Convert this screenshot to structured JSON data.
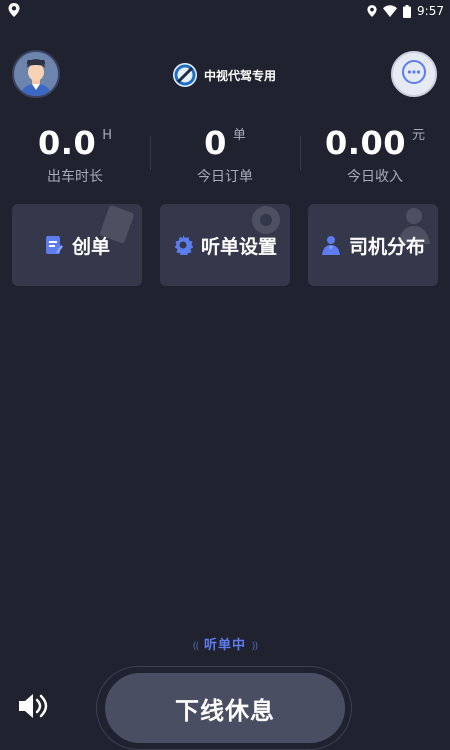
{
  "status_bar": {
    "time": "9:57",
    "icons": [
      "location-icon",
      "wifi-icon",
      "battery-icon"
    ]
  },
  "header": {
    "brand_name": "中视代驾专用",
    "avatar": "driver-avatar",
    "chat_icon": "chat-bubble-icon"
  },
  "stats": [
    {
      "value": "0.0",
      "unit": "H",
      "label": "出车时长"
    },
    {
      "value": "0",
      "unit": "单",
      "label": "今日订单"
    },
    {
      "value": "0.00",
      "unit": "元",
      "label": "今日收入"
    }
  ],
  "actions": [
    {
      "label": "创单",
      "icon": "create-order-icon"
    },
    {
      "label": "听单设置",
      "icon": "settings-gear-icon"
    },
    {
      "label": "司机分布",
      "icon": "driver-person-icon"
    }
  ],
  "listening_status": "听单中",
  "offline_button": "下线休息",
  "colors": {
    "background": "#20232f",
    "card": "#34384a",
    "accent": "#5d7cf0",
    "muted_text": "#a6abb8",
    "offline_button": "#4a4e63"
  }
}
